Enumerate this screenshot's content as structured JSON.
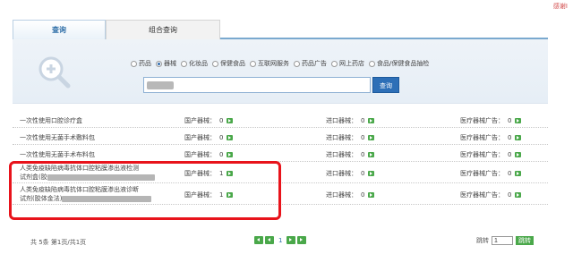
{
  "top_note": "感谢I",
  "tabs": [
    {
      "label": "查询"
    },
    {
      "label": "组合查询"
    }
  ],
  "search": {
    "options": [
      {
        "label": "药品",
        "selected": false
      },
      {
        "label": "器械",
        "selected": true
      },
      {
        "label": "化妆品",
        "selected": false
      },
      {
        "label": "保健食品",
        "selected": false
      },
      {
        "label": "互联网服务",
        "selected": false
      },
      {
        "label": "药品广告",
        "selected": false
      },
      {
        "label": "网上药店",
        "selected": false
      },
      {
        "label": "食品/保健食品抽检",
        "selected": false
      }
    ],
    "button_label": "查询"
  },
  "results": [
    {
      "name": "一次性使用口腔诊疗盒",
      "domestic_label": "国产器械：",
      "domestic": "0",
      "import_label": "进口器械：",
      "import": "0",
      "ad_label": "医疗器械广告：",
      "ad": "0"
    },
    {
      "name": "一次性使用无菌手术敷料包",
      "domestic_label": "国产器械：",
      "domestic": "0",
      "import_label": "进口器械：",
      "import": "0",
      "ad_label": "医疗器械广告：",
      "ad": "0"
    },
    {
      "name": "一次性使用无菌手术布料包",
      "domestic_label": "国产器械：",
      "domestic": "0",
      "import_label": "进口器械：",
      "import": "0",
      "ad_label": "医疗器械广告：",
      "ad": "0"
    },
    {
      "name_line1": "人类免疫缺陷病毒抗体口腔粘膜渗出液检测",
      "name_line2": "试剂盒(胶",
      "domestic_label": "国产器械：",
      "domestic": "1",
      "import_label": "进口器械：",
      "import": "0",
      "ad_label": "医疗器械广告：",
      "ad": "0"
    },
    {
      "name_line1": "人类免疫缺陷病毒抗体口腔粘膜渗出液诊断",
      "name_line2": "试剂(胶体金法)",
      "domestic_label": "国产器械：",
      "domestic": "1",
      "import_label": "进口器械：",
      "import": "0",
      "ad_label": "医疗器械广告：",
      "ad": "0"
    }
  ],
  "footer": {
    "summary": "共 5条    第1页/共1页",
    "page_number": "1",
    "jump_label": "跳转",
    "jump_value": "1",
    "jump_button": "跳转"
  },
  "colors": {
    "accent": "#2d6fb7",
    "highlight": "#e8131b",
    "go_button": "#4aa84a"
  }
}
